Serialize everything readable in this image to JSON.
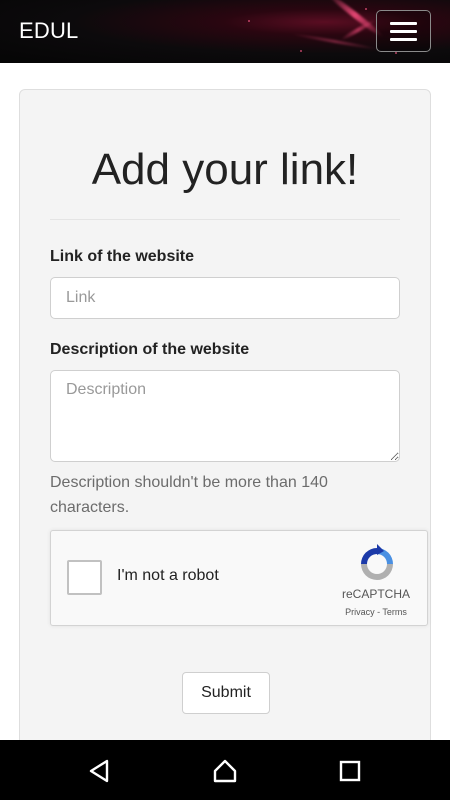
{
  "navbar": {
    "brand": "EDUL",
    "menu_icon": "hamburger-menu-icon"
  },
  "form": {
    "title": "Add your link!",
    "link_label": "Link of the website",
    "link_placeholder": "Link",
    "link_value": "",
    "description_label": "Description of the website",
    "description_placeholder": "Description",
    "description_value": "",
    "help_text": "Description shouldn't be more than 140 characters.",
    "recaptcha": {
      "checkbox_label": "I'm not a robot",
      "brand": "reCAPTCHA",
      "terms": "Privacy - Terms",
      "checked": false
    },
    "submit_label": "Submit"
  },
  "system_bar": {
    "back_icon": "back-triangle-icon",
    "home_icon": "home-icon",
    "recent_icon": "recent-apps-square-icon"
  },
  "colors": {
    "card_background": "#f4f4f4",
    "navbar_background": "#050505",
    "recaptcha_blue": "#4a90e2",
    "recaptcha_gray": "#b0b0b0"
  }
}
